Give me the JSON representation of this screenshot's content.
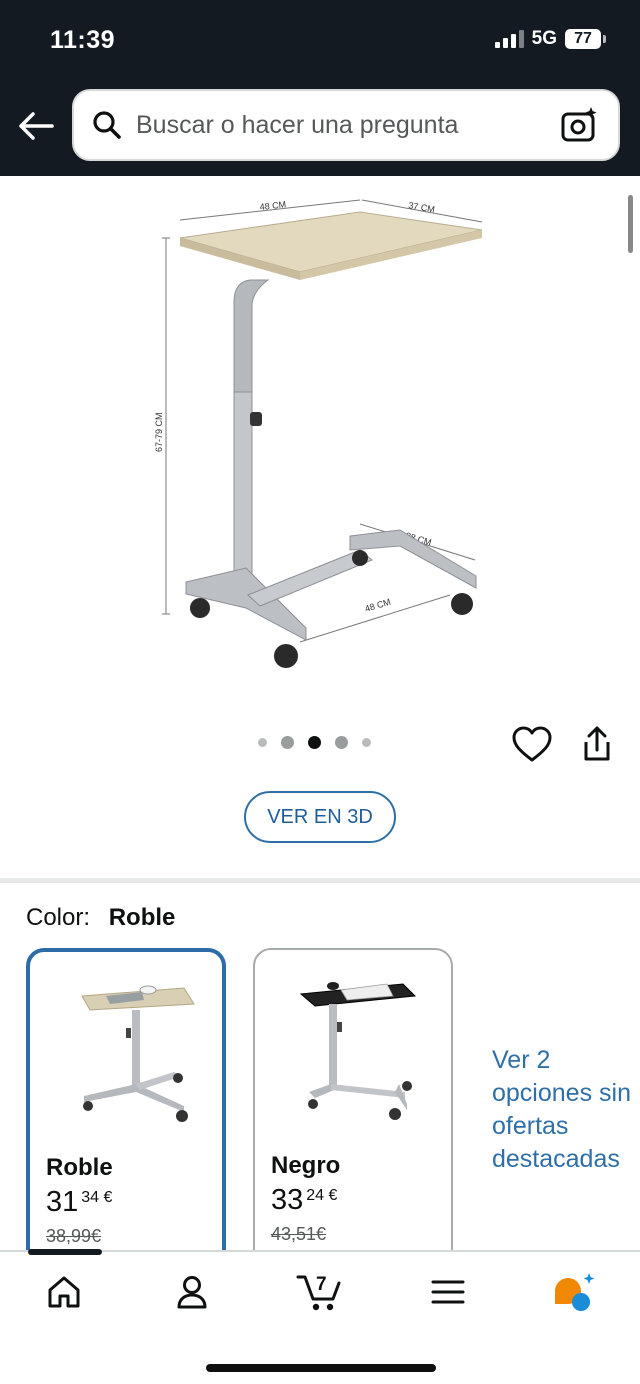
{
  "status_bar": {
    "time": "11:39",
    "network": "5G",
    "battery": "77"
  },
  "search": {
    "placeholder": "Buscar o hacer una pregunta"
  },
  "product_image": {
    "dimensions": {
      "top_width": "48 CM",
      "top_depth": "37 CM",
      "height": "67-79 CM",
      "base_depth": "38 CM",
      "base_width": "48 CM"
    }
  },
  "carousel": {
    "total": 5,
    "active_index": 2
  },
  "buttons": {
    "view_3d": "VER EN 3D"
  },
  "color": {
    "label": "Color:",
    "value": "Roble"
  },
  "variants": [
    {
      "name": "Roble",
      "price_whole": "31",
      "price_fraction": "34 €",
      "list_price": "38,99€",
      "selected": true,
      "top_color": "#d9cfb4"
    },
    {
      "name": "Negro",
      "price_whole": "33",
      "price_fraction": "24 €",
      "list_price": "43,51€",
      "selected": false,
      "top_color": "#222222"
    }
  ],
  "more_options": "Ver 2 opciones sin ofertas destacadas",
  "bottom_nav": {
    "items": [
      "home-icon",
      "account-icon",
      "cart-icon",
      "menu-icon",
      "rufus-icon"
    ],
    "cart_count": "7",
    "active_index": 0
  },
  "colors": {
    "header": "#131a22",
    "link": "#2f6fa8",
    "selected_border": "#2d6ca8",
    "rufus_orange": "#f08804",
    "rufus_blue": "#1a8cd8"
  }
}
